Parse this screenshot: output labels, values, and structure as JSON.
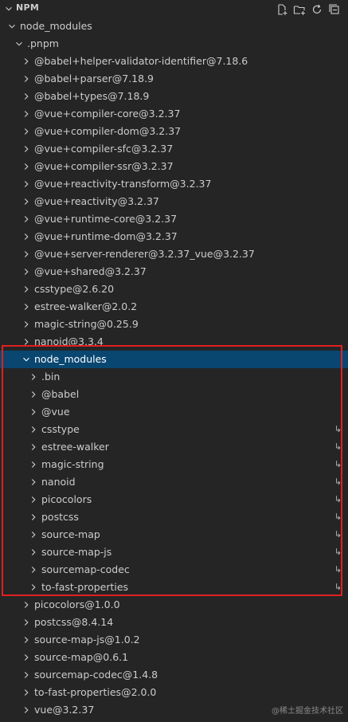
{
  "header": {
    "title": "NPM"
  },
  "actions": [
    {
      "name": "new-file-icon"
    },
    {
      "name": "new-folder-icon"
    },
    {
      "name": "refresh-icon"
    },
    {
      "name": "collapse-all-icon"
    }
  ],
  "tree": [
    {
      "label": "node_modules",
      "level": 1,
      "expanded": true
    },
    {
      "label": ".pnpm",
      "level": 2,
      "expanded": true
    },
    {
      "label": "@babel+helper-validator-identifier@7.18.6",
      "level": 3
    },
    {
      "label": "@babel+parser@7.18.9",
      "level": 3
    },
    {
      "label": "@babel+types@7.18.9",
      "level": 3
    },
    {
      "label": "@vue+compiler-core@3.2.37",
      "level": 3
    },
    {
      "label": "@vue+compiler-dom@3.2.37",
      "level": 3
    },
    {
      "label": "@vue+compiler-sfc@3.2.37",
      "level": 3
    },
    {
      "label": "@vue+compiler-ssr@3.2.37",
      "level": 3
    },
    {
      "label": "@vue+reactivity-transform@3.2.37",
      "level": 3
    },
    {
      "label": "@vue+reactivity@3.2.37",
      "level": 3
    },
    {
      "label": "@vue+runtime-core@3.2.37",
      "level": 3
    },
    {
      "label": "@vue+runtime-dom@3.2.37",
      "level": 3
    },
    {
      "label": "@vue+server-renderer@3.2.37_vue@3.2.37",
      "level": 3
    },
    {
      "label": "@vue+shared@3.2.37",
      "level": 3
    },
    {
      "label": "csstype@2.6.20",
      "level": 3
    },
    {
      "label": "estree-walker@2.0.2",
      "level": 3
    },
    {
      "label": "magic-string@0.25.9",
      "level": 3
    },
    {
      "label": "nanoid@3.3.4",
      "level": 3
    },
    {
      "label": "node_modules",
      "level": 3,
      "expanded": true,
      "selected": true
    },
    {
      "label": ".bin",
      "level": 4
    },
    {
      "label": "@babel",
      "level": 4
    },
    {
      "label": "@vue",
      "level": 4
    },
    {
      "label": "csstype",
      "level": 4,
      "link": true
    },
    {
      "label": "estree-walker",
      "level": 4,
      "link": true
    },
    {
      "label": "magic-string",
      "level": 4,
      "link": true
    },
    {
      "label": "nanoid",
      "level": 4,
      "link": true
    },
    {
      "label": "picocolors",
      "level": 4,
      "link": true
    },
    {
      "label": "postcss",
      "level": 4,
      "link": true
    },
    {
      "label": "source-map",
      "level": 4,
      "link": true
    },
    {
      "label": "source-map-js",
      "level": 4,
      "link": true
    },
    {
      "label": "sourcemap-codec",
      "level": 4,
      "link": true
    },
    {
      "label": "to-fast-properties",
      "level": 4,
      "link": true
    },
    {
      "label": "picocolors@1.0.0",
      "level": 3
    },
    {
      "label": "postcss@8.4.14",
      "level": 3
    },
    {
      "label": "source-map-js@1.0.2",
      "level": 3
    },
    {
      "label": "source-map@0.6.1",
      "level": 3
    },
    {
      "label": "sourcemap-codec@1.4.8",
      "level": 3
    },
    {
      "label": "to-fast-properties@2.0.0",
      "level": 3
    },
    {
      "label": "vue@3.2.37",
      "level": 3
    }
  ],
  "link_glyph": "↳",
  "watermark": "@稀土掘金技术社区",
  "colors": {
    "selection": "#094771",
    "highlight_border": "#e02020",
    "background": "#252526"
  }
}
